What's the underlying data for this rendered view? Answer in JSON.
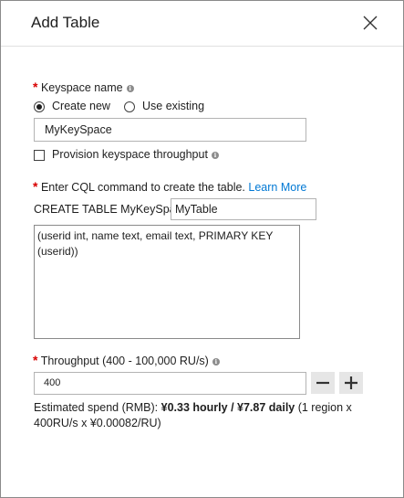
{
  "header": {
    "title": "Add Table",
    "close_icon": "close-icon"
  },
  "keyspace": {
    "label": "Keyspace name",
    "required_marker": "*",
    "info_icon": "i",
    "radio_create_new": "Create new",
    "radio_use_existing": "Use existing",
    "selected": "Create new",
    "name_value": "MyKeySpace",
    "provision_label": "Provision keyspace throughput",
    "provision_checked": false
  },
  "cql": {
    "required_marker": "*",
    "label": "Enter CQL command to create the table.",
    "learn_more": "Learn More",
    "prefix": "CREATE TABLE MyKeySpace.",
    "table_name_value": "MyTable",
    "schema_value": "(userid int, name text, email text, PRIMARY KEY (userid))"
  },
  "throughput": {
    "required_marker": "*",
    "label": "Throughput (400 - 100,000 RU/s)",
    "info_icon": "i",
    "value": "400",
    "decrement_icon": "minus-icon",
    "increment_icon": "plus-icon"
  },
  "estimate": {
    "prefix": "Estimated spend (RMB): ",
    "bold": "¥0.33 hourly / ¥7.87 daily",
    "suffix": " (1 region x 400RU/s x ¥0.00082/RU)"
  },
  "colors": {
    "accent_link": "#0078d4",
    "required": "#d80000"
  }
}
